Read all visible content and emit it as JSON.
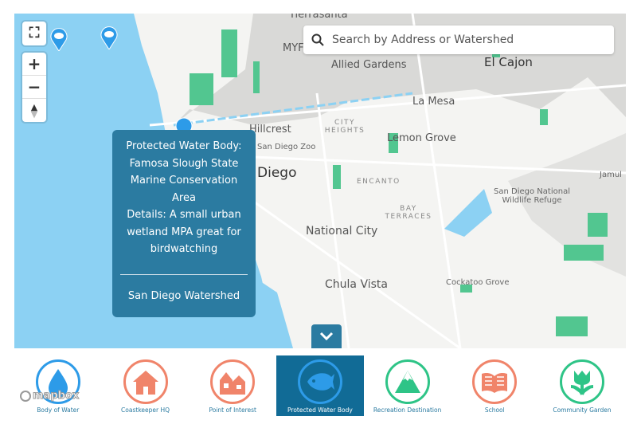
{
  "map": {
    "labels": {
      "tierrasanta": "Tierrasanta",
      "myf": "MYF",
      "allied": "Allied Gardens",
      "elcajon": "El Cajon",
      "lamesa": "La Mesa",
      "hillcrest": "Hillcrest",
      "cityheights": "CITY HEIGHTS",
      "lemongrove": "Lemon Grove",
      "zoo": "San Diego Zoo",
      "diego": "Diego",
      "encanto": "ENCANTO",
      "baytr": "BAY TERRACES",
      "nationalcity": "National City",
      "refuge": "San Diego National Wildlife Refuge",
      "jamul": "Jamul",
      "chulavista": "Chula Vista",
      "cockatoo": "Cockatoo Grove"
    },
    "controls": {
      "zoom_in": "+",
      "zoom_out": "−"
    },
    "search": {
      "placeholder": "Search by Address or Watershed",
      "value": ""
    },
    "popup": {
      "line1": "Protected Water Body:",
      "line2": "Famosa Slough State Marine Conservation Area",
      "line3": "Details: A small urban wetland MPA great for birdwatching",
      "watershed": "San Diego Watershed"
    },
    "attribution": "mapbox"
  },
  "colors": {
    "water": "#8cd1f3",
    "park": "#52c690",
    "popup": "#2b7ba1",
    "active": "#116b96",
    "blue": "#2d9be8",
    "orange": "#f0846a",
    "green": "#2ec487"
  },
  "legend": [
    {
      "label": "Body of Water",
      "icon": "water-drop-icon",
      "color": "#2d9be8"
    },
    {
      "label": "Coastkeeper HQ",
      "icon": "house-icon",
      "color": "#f0846a"
    },
    {
      "label": "Point of Interest",
      "icon": "buildings-icon",
      "color": "#f0846a"
    },
    {
      "label": "Protected Water Body",
      "icon": "fish-icon",
      "color": "#2d9be8",
      "active": true
    },
    {
      "label": "Recreation Destination",
      "icon": "mountain-icon",
      "color": "#2ec487"
    },
    {
      "label": "School",
      "icon": "book-icon",
      "color": "#f0846a"
    },
    {
      "label": "Community Garden",
      "icon": "tulip-icon",
      "color": "#2ec487"
    }
  ]
}
